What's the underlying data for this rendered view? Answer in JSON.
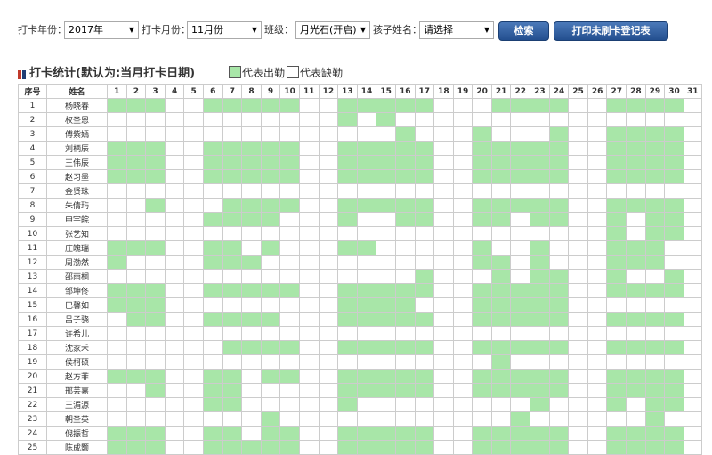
{
  "filters": {
    "year_label": "打卡年份：",
    "year_value": "2017年",
    "month_label": "打卡月份：",
    "month_value": "11月份",
    "class_label": "班级：",
    "class_value": "月光石(开启)",
    "child_label": "孩子姓名：",
    "child_value": "请选择",
    "search_label": "检索",
    "print_label": "打印未刷卡登记表"
  },
  "section": {
    "title": "打卡统计(默认为:当月打卡日期)",
    "legend_present": "代表出勤",
    "legend_absent": "代表缺勤"
  },
  "colors": {
    "present": "#a8e6a8",
    "absent": "#ffffff",
    "button": "#2b5a9c"
  },
  "table": {
    "headers": {
      "index": "序号",
      "name": "姓名"
    },
    "days": [
      "1",
      "2",
      "3",
      "4",
      "5",
      "6",
      "7",
      "8",
      "9",
      "10",
      "11",
      "12",
      "13",
      "14",
      "15",
      "16",
      "17",
      "18",
      "19",
      "20",
      "21",
      "22",
      "23",
      "24",
      "25",
      "26",
      "27",
      "28",
      "29",
      "30",
      "31"
    ],
    "rows": [
      {
        "index": "1",
        "name": "杨晓春",
        "days": [
          1,
          1,
          1,
          0,
          0,
          1,
          1,
          1,
          1,
          1,
          0,
          0,
          1,
          1,
          1,
          1,
          1,
          0,
          0,
          0,
          1,
          1,
          1,
          1,
          0,
          0,
          1,
          1,
          1,
          1,
          0
        ]
      },
      {
        "index": "2",
        "name": "权圣恩",
        "days": [
          0,
          0,
          0,
          0,
          0,
          0,
          0,
          0,
          0,
          0,
          0,
          0,
          1,
          0,
          1,
          0,
          0,
          0,
          0,
          0,
          0,
          0,
          0,
          0,
          0,
          0,
          0,
          0,
          0,
          0,
          0
        ]
      },
      {
        "index": "3",
        "name": "傅紫嫣",
        "days": [
          0,
          0,
          0,
          0,
          0,
          0,
          0,
          0,
          0,
          0,
          0,
          0,
          0,
          0,
          0,
          1,
          0,
          0,
          0,
          1,
          0,
          0,
          0,
          1,
          0,
          0,
          1,
          1,
          1,
          1,
          0
        ]
      },
      {
        "index": "4",
        "name": "刘柄辰",
        "days": [
          1,
          1,
          1,
          0,
          0,
          1,
          1,
          1,
          1,
          1,
          0,
          0,
          1,
          1,
          1,
          1,
          1,
          0,
          0,
          1,
          1,
          1,
          1,
          1,
          0,
          0,
          1,
          1,
          1,
          1,
          0
        ]
      },
      {
        "index": "5",
        "name": "王伟辰",
        "days": [
          1,
          1,
          1,
          0,
          0,
          1,
          1,
          1,
          1,
          1,
          0,
          0,
          1,
          1,
          1,
          1,
          1,
          0,
          0,
          1,
          1,
          1,
          1,
          1,
          0,
          0,
          1,
          1,
          1,
          1,
          0
        ]
      },
      {
        "index": "6",
        "name": "赵习墨",
        "days": [
          1,
          1,
          1,
          0,
          0,
          1,
          1,
          1,
          1,
          1,
          0,
          0,
          1,
          1,
          1,
          1,
          1,
          0,
          0,
          1,
          1,
          1,
          1,
          1,
          0,
          0,
          1,
          1,
          1,
          1,
          0
        ]
      },
      {
        "index": "7",
        "name": "金贤珠",
        "days": [
          0,
          0,
          0,
          0,
          0,
          0,
          0,
          0,
          0,
          0,
          0,
          0,
          0,
          0,
          0,
          0,
          0,
          0,
          0,
          0,
          0,
          0,
          0,
          0,
          0,
          0,
          0,
          0,
          0,
          0,
          0
        ]
      },
      {
        "index": "8",
        "name": "朱倩玙",
        "days": [
          0,
          0,
          1,
          0,
          0,
          0,
          1,
          1,
          1,
          1,
          0,
          0,
          1,
          1,
          1,
          1,
          1,
          0,
          0,
          1,
          1,
          1,
          1,
          1,
          0,
          0,
          1,
          1,
          1,
          1,
          0
        ]
      },
      {
        "index": "9",
        "name": "申宇皖",
        "days": [
          0,
          0,
          0,
          0,
          0,
          1,
          1,
          1,
          1,
          0,
          0,
          0,
          1,
          0,
          0,
          1,
          1,
          0,
          0,
          1,
          1,
          0,
          1,
          1,
          0,
          0,
          1,
          0,
          1,
          1,
          0
        ]
      },
      {
        "index": "10",
        "name": "张艺知",
        "days": [
          0,
          0,
          0,
          0,
          0,
          0,
          0,
          0,
          0,
          0,
          0,
          0,
          0,
          0,
          0,
          0,
          0,
          0,
          0,
          0,
          0,
          0,
          0,
          0,
          0,
          0,
          1,
          0,
          1,
          1,
          0
        ]
      },
      {
        "index": "11",
        "name": "庄魄瑞",
        "days": [
          1,
          1,
          1,
          0,
          0,
          1,
          1,
          0,
          1,
          0,
          0,
          0,
          1,
          1,
          0,
          0,
          0,
          0,
          0,
          1,
          0,
          0,
          1,
          0,
          0,
          0,
          1,
          1,
          1,
          0,
          0
        ]
      },
      {
        "index": "12",
        "name": "周渤然",
        "days": [
          1,
          0,
          0,
          0,
          0,
          1,
          1,
          1,
          0,
          0,
          0,
          0,
          0,
          0,
          0,
          0,
          0,
          0,
          0,
          1,
          1,
          0,
          1,
          0,
          0,
          0,
          1,
          1,
          1,
          0,
          0
        ]
      },
      {
        "index": "13",
        "name": "邵雨桐",
        "days": [
          0,
          0,
          0,
          0,
          0,
          0,
          0,
          0,
          0,
          0,
          0,
          0,
          0,
          0,
          0,
          0,
          1,
          0,
          0,
          0,
          1,
          0,
          1,
          1,
          0,
          0,
          1,
          0,
          0,
          1,
          0
        ]
      },
      {
        "index": "14",
        "name": "邹坤佟",
        "days": [
          1,
          1,
          1,
          0,
          0,
          1,
          1,
          1,
          1,
          1,
          0,
          0,
          1,
          1,
          1,
          1,
          1,
          0,
          0,
          1,
          1,
          1,
          1,
          1,
          0,
          0,
          1,
          1,
          1,
          1,
          0
        ]
      },
      {
        "index": "15",
        "name": "巴馨如",
        "days": [
          1,
          1,
          1,
          0,
          0,
          0,
          0,
          0,
          0,
          0,
          0,
          0,
          1,
          1,
          1,
          1,
          0,
          0,
          0,
          1,
          1,
          1,
          1,
          1,
          0,
          0,
          0,
          0,
          0,
          0,
          0
        ]
      },
      {
        "index": "16",
        "name": "吕子骁",
        "days": [
          0,
          1,
          1,
          0,
          0,
          1,
          1,
          1,
          1,
          0,
          0,
          0,
          1,
          1,
          1,
          1,
          1,
          0,
          0,
          1,
          1,
          1,
          1,
          1,
          0,
          0,
          1,
          1,
          1,
          1,
          0
        ]
      },
      {
        "index": "17",
        "name": "许希儿",
        "days": [
          0,
          0,
          0,
          0,
          0,
          0,
          0,
          0,
          0,
          0,
          0,
          0,
          0,
          0,
          0,
          0,
          0,
          0,
          0,
          0,
          0,
          0,
          0,
          0,
          0,
          0,
          0,
          0,
          0,
          0,
          0
        ]
      },
      {
        "index": "18",
        "name": "沈家禾",
        "days": [
          0,
          0,
          0,
          0,
          0,
          0,
          1,
          1,
          1,
          1,
          0,
          0,
          1,
          1,
          1,
          1,
          1,
          0,
          0,
          1,
          1,
          1,
          1,
          1,
          0,
          0,
          1,
          1,
          1,
          1,
          0
        ]
      },
      {
        "index": "19",
        "name": "侯柯硕",
        "days": [
          0,
          0,
          0,
          0,
          0,
          0,
          0,
          0,
          0,
          0,
          0,
          0,
          0,
          0,
          0,
          0,
          0,
          0,
          0,
          0,
          1,
          0,
          0,
          0,
          0,
          0,
          0,
          0,
          0,
          0,
          0
        ]
      },
      {
        "index": "20",
        "name": "赵方菲",
        "days": [
          1,
          1,
          1,
          0,
          0,
          1,
          1,
          0,
          1,
          1,
          0,
          0,
          1,
          1,
          1,
          1,
          1,
          0,
          0,
          1,
          1,
          1,
          1,
          1,
          0,
          0,
          1,
          1,
          1,
          1,
          0
        ]
      },
      {
        "index": "21",
        "name": "邢芸嘉",
        "days": [
          0,
          0,
          1,
          0,
          0,
          1,
          1,
          0,
          0,
          0,
          0,
          0,
          1,
          1,
          1,
          1,
          1,
          0,
          0,
          1,
          1,
          1,
          1,
          1,
          0,
          0,
          1,
          1,
          1,
          1,
          0
        ]
      },
      {
        "index": "22",
        "name": "王湄源",
        "days": [
          0,
          0,
          0,
          0,
          0,
          1,
          1,
          0,
          0,
          0,
          0,
          0,
          1,
          0,
          0,
          0,
          0,
          0,
          0,
          0,
          0,
          0,
          1,
          0,
          0,
          0,
          1,
          0,
          1,
          1,
          0
        ]
      },
      {
        "index": "23",
        "name": "朝圣英",
        "days": [
          0,
          0,
          0,
          0,
          0,
          0,
          0,
          0,
          1,
          0,
          0,
          0,
          0,
          0,
          0,
          0,
          0,
          0,
          0,
          0,
          0,
          1,
          0,
          0,
          0,
          0,
          0,
          0,
          1,
          0,
          0
        ]
      },
      {
        "index": "24",
        "name": "倪振哲",
        "days": [
          1,
          1,
          1,
          0,
          0,
          1,
          1,
          0,
          1,
          1,
          0,
          0,
          1,
          1,
          1,
          1,
          1,
          0,
          0,
          1,
          1,
          1,
          1,
          1,
          0,
          0,
          1,
          1,
          1,
          1,
          0
        ]
      },
      {
        "index": "25",
        "name": "陈成颢",
        "days": [
          1,
          1,
          1,
          0,
          0,
          1,
          1,
          1,
          1,
          1,
          0,
          0,
          1,
          1,
          1,
          1,
          1,
          0,
          0,
          1,
          1,
          1,
          1,
          1,
          0,
          0,
          1,
          1,
          1,
          1,
          0
        ]
      }
    ]
  }
}
